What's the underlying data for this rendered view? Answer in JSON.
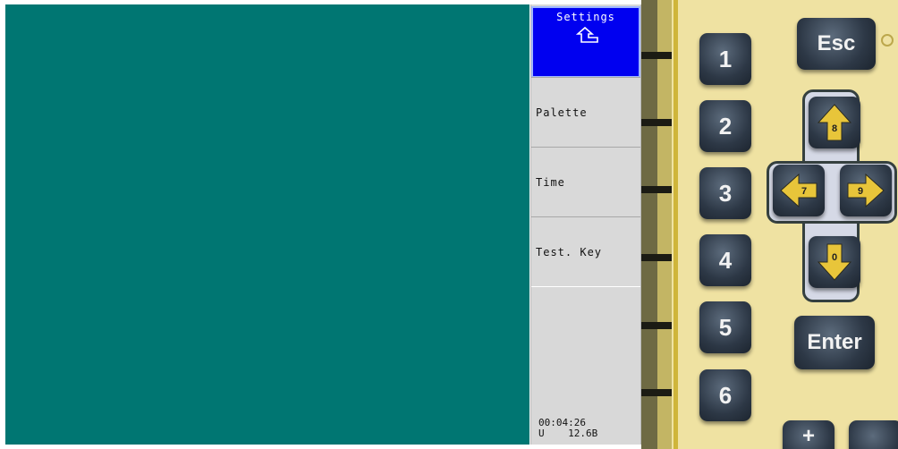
{
  "menu": {
    "items": [
      {
        "label": "Settings",
        "selected": true
      },
      {
        "label": "Palette",
        "selected": false
      },
      {
        "label": "Time",
        "selected": false
      },
      {
        "label": "Test. Key",
        "selected": false
      }
    ],
    "up_icon": "return-up-arrow-icon"
  },
  "status": {
    "time": "00:04:26",
    "voltage": "U    12.6B"
  },
  "keypad": {
    "number_keys": [
      "1",
      "2",
      "3",
      "4",
      "5",
      "6"
    ],
    "esc_label": "Esc",
    "enter_label": "Enter",
    "plus_label": "+",
    "arrow_keys": {
      "up": "8",
      "left": "7",
      "right": "9",
      "down": "0"
    }
  },
  "colors": {
    "display_background": "#007672",
    "menu_selected": "#0000f0",
    "menu_background": "#d9d9d9",
    "keypad_panel": "#efe2a2",
    "arrow_fill": "#e8c53a"
  }
}
